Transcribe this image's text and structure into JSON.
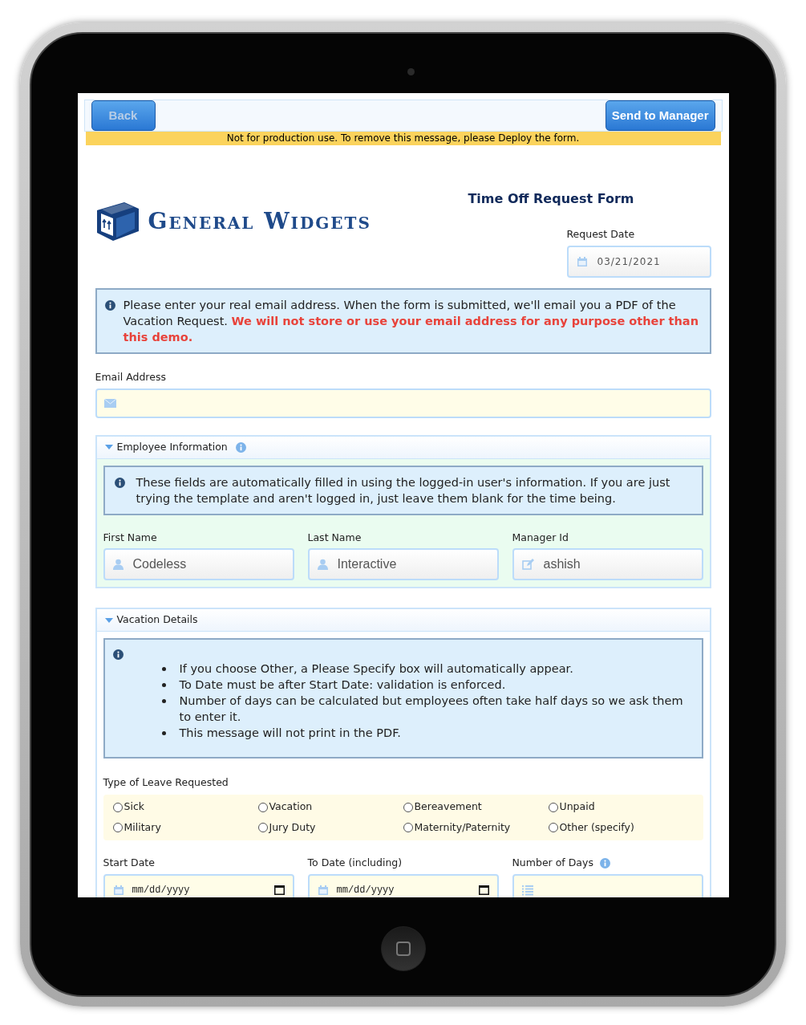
{
  "toolbar": {
    "back_button": "Back",
    "send_button": "Send to Manager"
  },
  "notice": "Not for production use. To remove this message, please Deploy the form.",
  "logo": {
    "text": "General Widgets"
  },
  "form_title": "Time Off Request Form",
  "request_date": {
    "label": "Request Date",
    "value": "03/21/2021"
  },
  "email_info": "Please enter your real email address. When the form is submitted, we'll email you a PDF of the Vacation Request. **We will not store or use your email address for any purpose other than this demo.**",
  "email": {
    "label": "Email Address"
  },
  "employee_section": {
    "title": "Employee Information",
    "expanded": true,
    "info": "These fields are automatically filled in using the logged-in user's information. If you are just trying the template and aren't logged in, just leave them blank for the time being.",
    "fields": [
      {
        "label": "First Name",
        "value": "Codeless",
        "kind": "person"
      },
      {
        "label": "Last Name",
        "value": "Interactive",
        "kind": "person"
      },
      {
        "label": "Manager Id",
        "value": "ashish",
        "kind": "edit"
      }
    ]
  },
  "vacation_section": {
    "title": "Vacation Details",
    "expanded": true,
    "info_items": [
      "If you choose Other, a Please Specify box will automatically appear.",
      "To Date must be after Start Date: validation is enforced.",
      "Number of days can be calculated but employees often take half days so we ask them to enter it.",
      "This message will not print in the PDF."
    ],
    "leave_label": "Type of Leave Requested",
    "leave_types": [
      {
        "label": "Sick",
        "selected": false
      },
      {
        "label": "Vacation",
        "selected": false
      },
      {
        "label": "Bereavement",
        "selected": false
      },
      {
        "label": "Unpaid",
        "selected": false
      },
      {
        "label": "Military",
        "selected": false
      },
      {
        "label": "Jury Duty",
        "selected": false
      },
      {
        "label": "Maternity/Paternity",
        "selected": false
      },
      {
        "label": "Other (specify)",
        "selected": false
      }
    ],
    "date_fields": [
      {
        "label": "Start Date",
        "placeholder": "mm/dd/yyyy",
        "kind": "date"
      },
      {
        "label": "To Date (including)",
        "placeholder": "mm/dd/yyyy",
        "kind": "date"
      },
      {
        "label": "Number of Days",
        "kind": "number"
      }
    ]
  }
}
